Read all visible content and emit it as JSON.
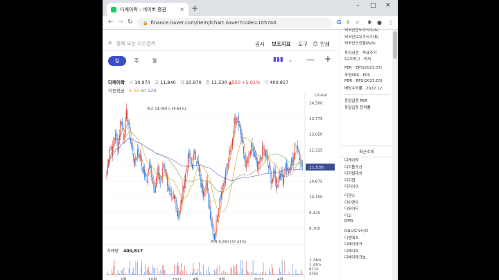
{
  "browser": {
    "tab_title": "디케이락 : 네이버 증권",
    "url": "finance.naver.com/item/fchart.naver?code=105740",
    "new_tab": "+",
    "close": "×",
    "win_min": "–",
    "win_max": "□",
    "win_close": "✕"
  },
  "search": {
    "placeholder": "종목 또는 지수검색"
  },
  "menu": {
    "notice": "공시",
    "indicator": "보조지표",
    "tools": "도구",
    "print": "인쇄"
  },
  "periods": {
    "day": "일",
    "week": "주",
    "month": "월",
    "selected": "day"
  },
  "ohlc": {
    "name": "디케이락",
    "open_label": "시",
    "open": "10,970",
    "high_label": "고",
    "high": "11,840",
    "low_label": "저",
    "low": "10,970",
    "close_label": "종",
    "close": "11,530",
    "change": "▲550",
    "change_pct": "+5.01%",
    "volume_label": "거",
    "volume": "400,817"
  },
  "moving_avg": {
    "label": "이동평균",
    "ma5": "5",
    "ma20": "20",
    "ma60": "60",
    "ma120": "120"
  },
  "colors": {
    "up": "#e0322c",
    "down": "#1a73e8",
    "ma5": "#e07b3a",
    "ma20": "#d4a020",
    "ma60": "#6ba35c",
    "ma120": "#7b61c9",
    "accent": "#3a4fc7",
    "price_badge": "#3b4d8f"
  },
  "chart_data": {
    "type": "candlestick",
    "scale": "Linear",
    "y_ticks": [
      "14,500",
      "13,775",
      "13,050",
      "12,325",
      "11,600",
      "10,875",
      "10,150",
      "9,425",
      "8,700"
    ],
    "ylim": [
      8200,
      14800
    ],
    "current_price": "11,530",
    "high_annotation": "최고 14,050 (-19.65%)",
    "low_annotation": "최저 8,280 (37.43%)",
    "x_ticks": [
      "6월",
      "10월",
      "2022",
      "4월",
      "8월",
      "2023",
      "4월"
    ],
    "volume_label": "거래량",
    "volume_value": "400,817",
    "volume_ticks": [
      "1.74m",
      "1.31m",
      "871k",
      "435k"
    ],
    "price_path": [
      11200,
      12600,
      12200,
      13200,
      12400,
      13800,
      12900,
      14050,
      13100,
      12200,
      11700,
      12400,
      11900,
      11300,
      10900,
      11600,
      11100,
      10500,
      11400,
      10800,
      11700,
      11200,
      10300,
      9900,
      10200,
      9300,
      9700,
      10600,
      11400,
      12100,
      11600,
      12300,
      11700,
      10800,
      10400,
      10900,
      9700,
      8900,
      8280,
      9400,
      10200,
      10800,
      11300,
      11900,
      12600,
      13700,
      14000,
      13200,
      12300,
      11600,
      11900,
      12500,
      12000,
      11400,
      11800,
      12400,
      12100,
      11500,
      10900,
      11200,
      10700,
      11300,
      11000,
      11600,
      11200,
      11700,
      12200,
      12700,
      11800,
      11530
    ]
  },
  "sidebar": {
    "top_items": [
      "외국인한도주식수(A)",
      "외국인보유주식수(B)",
      "외국인소진율(B/A)",
      "투자의견 · 목표주가",
      "52주최고 · 최저",
      "PER · EPS(2023.03)",
      "추정PER · EPS",
      "PBR · BPS(2023.03)",
      "배당수익률 · 2022.12"
    ],
    "peer": [
      "동일업종 PER",
      "동일업종 등락률"
    ],
    "recent_title": "최근조회",
    "recent": [
      "디케이락",
      "디지틀조선",
      "디지털대성",
      "디지캡",
      "디지아이",
      "디젠스",
      "디이엔티",
      "디와이티",
      "디오",
      "DMS",
      "DN오토모티브",
      "디엔에프",
      "디에이테크",
      "디에이피",
      "디에이테크놀..."
    ]
  }
}
